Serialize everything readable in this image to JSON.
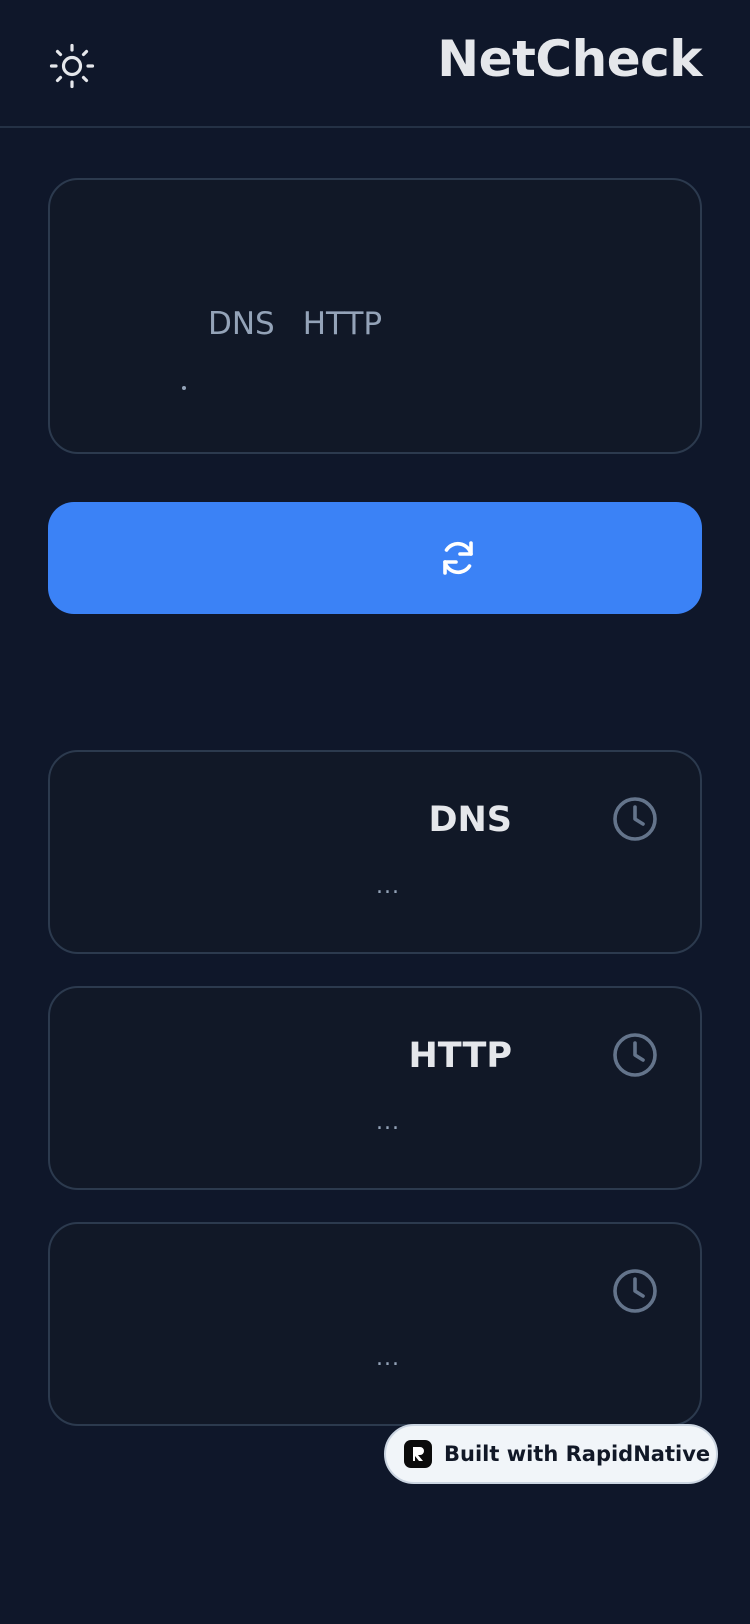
{
  "header": {
    "title": "NetCheck",
    "theme_icon": "sun-icon"
  },
  "input_panel": {
    "tabs": [
      {
        "label": "DNS"
      },
      {
        "label": "HTTP"
      }
    ],
    "value": "."
  },
  "run_button": {
    "icon": "refresh-icon"
  },
  "results": [
    {
      "title": "DNS",
      "status": "...",
      "icon": "clock-icon"
    },
    {
      "title": "HTTP",
      "status": "...",
      "icon": "clock-icon"
    },
    {
      "title": "",
      "status": "...",
      "icon": "clock-icon"
    }
  ],
  "badge": {
    "text": "Built with RapidNative",
    "icon": "rapidnative-logo"
  },
  "colors": {
    "background": "#0f172a",
    "card": "#111827",
    "accent": "#3b82f6",
    "muted": "#94a3b8",
    "text": "#e5e7eb"
  }
}
